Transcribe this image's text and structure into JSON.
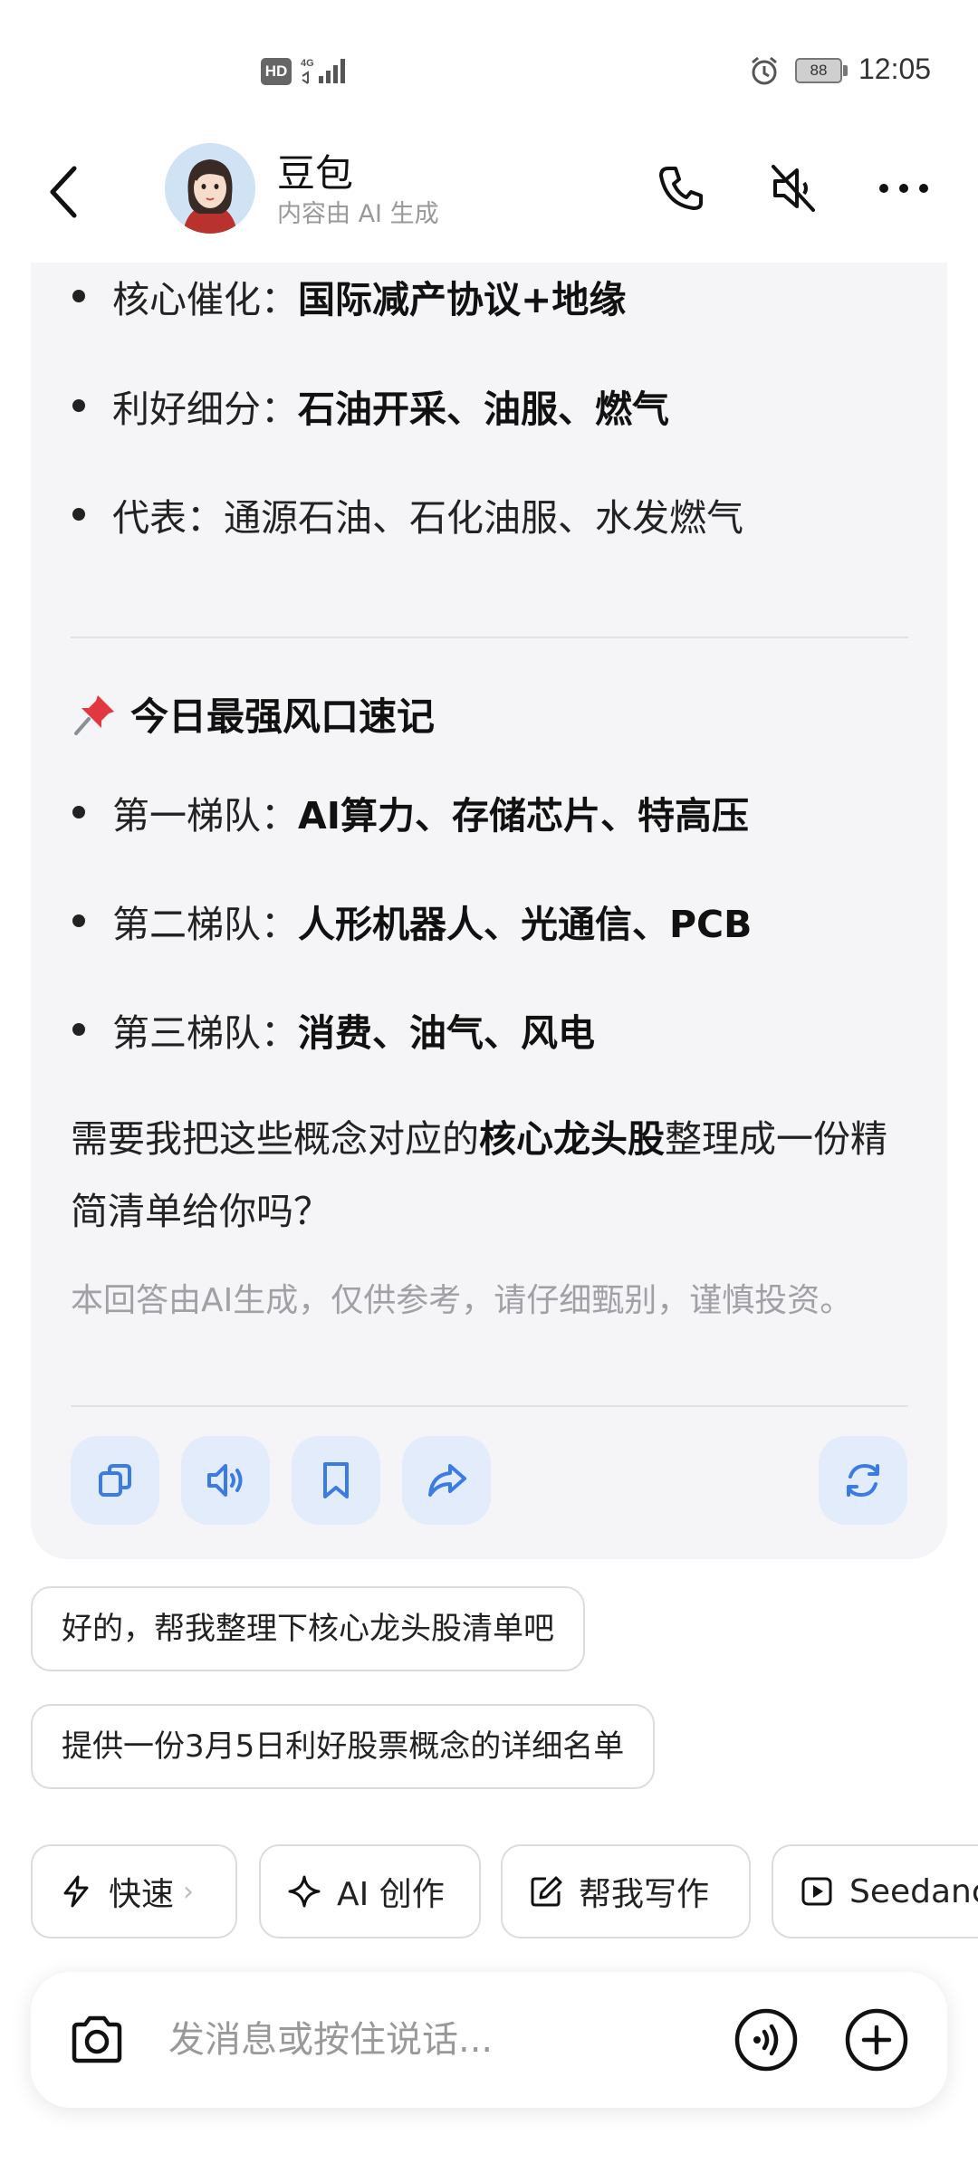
{
  "status_bar": {
    "hd": "HD",
    "network": "4G",
    "battery": "88",
    "time": "12:05"
  },
  "header": {
    "name": "豆包",
    "subtitle": "内容由 AI 生成"
  },
  "message": {
    "bullets_top": [
      {
        "label": "核心催化：",
        "value": "国际减产协议+地缘"
      },
      {
        "label": "利好细分：",
        "value": "石油开采、油服、燃气"
      },
      {
        "label": "代表：通源石油、石化油服、水发燃气",
        "value": ""
      }
    ],
    "section_title": "今日最强风口速记",
    "tiers": [
      {
        "label": "第一梯队：",
        "value": "AI算力、存储芯片、特高压"
      },
      {
        "label": "第二梯队：",
        "value": "人形机器人、光通信、PCB"
      },
      {
        "label": "第三梯队：",
        "value": "消费、油气、风电"
      }
    ],
    "question_prefix": "需要我把这些概念对应的",
    "question_bold": "核心龙头股",
    "question_suffix": "整理成一份精简清单给你吗？",
    "disclaimer": "本回答由AI生成，仅供参考，请仔细甄别，谨慎投资。"
  },
  "suggestions": [
    "好的，帮我整理下核心龙头股清单吧",
    "提供一份3月5日利好股票概念的详细名单"
  ],
  "chips": [
    {
      "label": "快速",
      "icon": "lightning-icon"
    },
    {
      "label": "AI 创作",
      "icon": "sparkle-icon"
    },
    {
      "label": "帮我写作",
      "icon": "edit-icon"
    },
    {
      "label": "Seedance",
      "icon": "play-icon"
    }
  ],
  "input": {
    "placeholder": "发消息或按住说话..."
  },
  "colors": {
    "accent": "#3b7be6",
    "card_bg": "#f5f5f7",
    "action_bg": "#e3ecfa"
  }
}
